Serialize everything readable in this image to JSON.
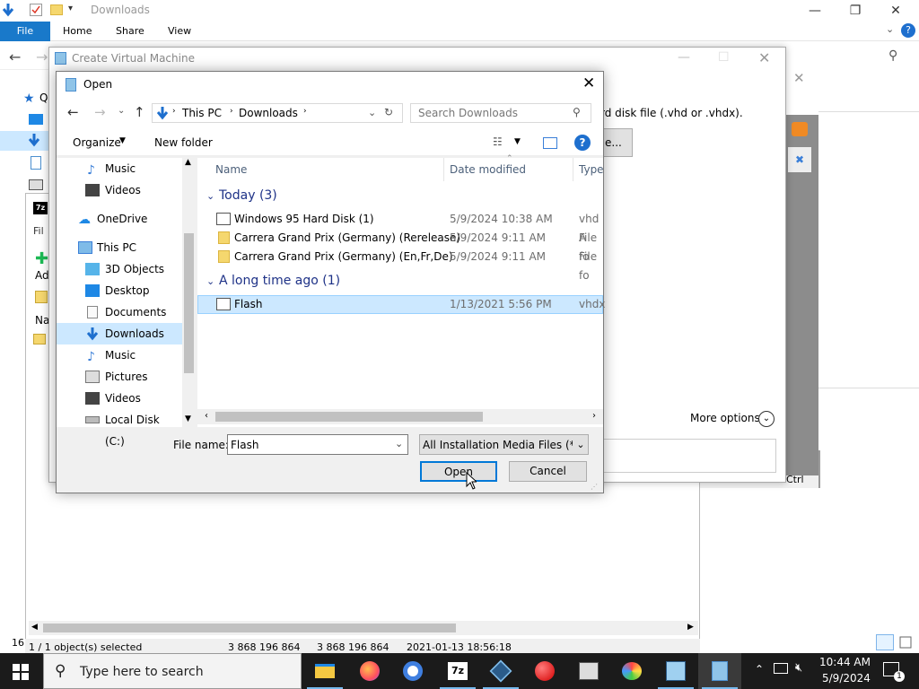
{
  "explorer": {
    "title": "Downloads",
    "ribbon": {
      "file": "File",
      "home": "Home",
      "share": "Share",
      "view": "View"
    },
    "side_letters": [
      "Q"
    ],
    "hint_labels": [
      "Fil",
      "Ad",
      "Na"
    ],
    "status_number": "16"
  },
  "sevenzip": {
    "status": {
      "selected": "1 / 1 object(s) selected",
      "size1": "3 868 196 864",
      "size2": "3 868 196 864",
      "datetime": "2021-01-13 18:56:18"
    }
  },
  "create_vm": {
    "title": "Create Virtual Machine",
    "disk_text": "rd disk file (.vhd or .vhdx).",
    "browse_label": "e...",
    "more_options": "More options",
    "ctrl_label": "Ctrl"
  },
  "open_dialog": {
    "title": "Open",
    "breadcrumb": [
      "This PC",
      "Downloads"
    ],
    "search_placeholder": "Search Downloads",
    "toolbar": {
      "organize": "Organize",
      "new_folder": "New folder"
    },
    "tree": [
      {
        "label": "Music",
        "icon": "music-icon"
      },
      {
        "label": "Videos",
        "icon": "video-icon"
      },
      {
        "label": "OneDrive",
        "icon": "cloud-icon"
      },
      {
        "label": "This PC",
        "icon": "computer-icon"
      },
      {
        "label": "3D Objects",
        "icon": "cube-icon"
      },
      {
        "label": "Desktop",
        "icon": "desktop-icon"
      },
      {
        "label": "Documents",
        "icon": "document-icon"
      },
      {
        "label": "Downloads",
        "icon": "download-icon"
      },
      {
        "label": "Music",
        "icon": "music-icon"
      },
      {
        "label": "Pictures",
        "icon": "picture-icon"
      },
      {
        "label": "Videos",
        "icon": "video-icon"
      },
      {
        "label": "Local Disk (C:)",
        "icon": "drive-icon"
      }
    ],
    "columns": {
      "name": "Name",
      "date": "Date modified",
      "type": "Type"
    },
    "groups": [
      {
        "label": "Today (3)",
        "files": [
          {
            "name": "Windows 95 Hard Disk (1)",
            "date": "5/9/2024 10:38 AM",
            "type": "vhd A"
          },
          {
            "name": "Carrera Grand Prix (Germany) (Rerelease)",
            "date": "5/9/2024 9:11 AM",
            "type": "File fo"
          },
          {
            "name": "Carrera Grand Prix (Germany) (En,Fr,De)",
            "date": "5/9/2024 9:11 AM",
            "type": "File fo"
          }
        ]
      },
      {
        "label": "A long time ago (1)",
        "files": [
          {
            "name": "Flash",
            "date": "1/13/2021 5:56 PM",
            "type": "vhdx"
          }
        ]
      }
    ],
    "filename_label": "File name:",
    "filename_value": "Flash",
    "filter_value": "All Installation Media Files (*.iso",
    "open_label": "Open",
    "cancel_label": "Cancel"
  },
  "taskbar": {
    "search_placeholder": "Type here to search",
    "time": "10:44 AM",
    "date": "5/9/2024",
    "notification_count": "1"
  },
  "colors": {
    "accent": "#1979ca",
    "selection": "#cce8ff",
    "taskbar": "#1b1b1b"
  }
}
